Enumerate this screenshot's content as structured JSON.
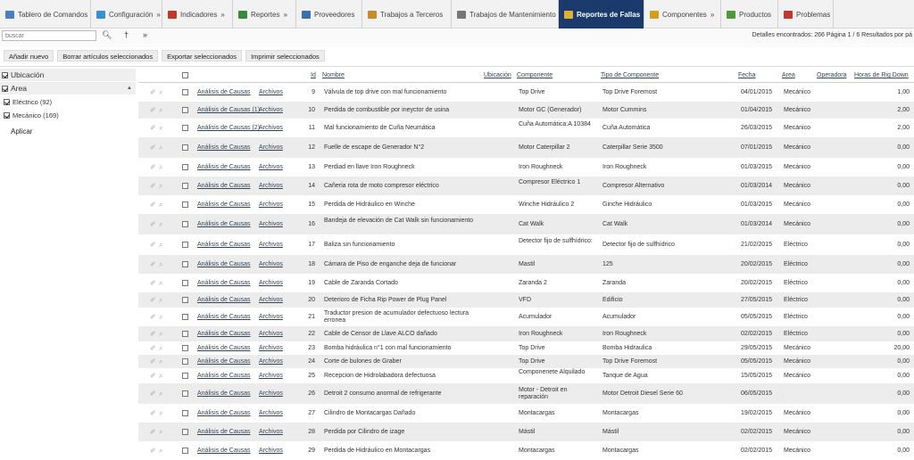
{
  "nav": {
    "tabs": [
      {
        "label": "Tablero de Comandos",
        "chev": "",
        "icon_color": "#4a7fc1",
        "width": 102,
        "active": false
      },
      {
        "label": "Configuración",
        "chev": "»",
        "icon_color": "#3a8fd0",
        "width": 80,
        "active": false
      },
      {
        "label": "Indicadores",
        "chev": "»",
        "icon_color": "#c0392b",
        "width": 79,
        "active": false
      },
      {
        "label": "Reportes",
        "chev": "»",
        "icon_color": "#3b8a3b",
        "width": 71,
        "active": false
      },
      {
        "label": "Proveedores",
        "chev": "",
        "icon_color": "#3a6fb0",
        "width": 74,
        "active": false
      },
      {
        "label": "Trabajos a Terceros",
        "chev": "",
        "icon_color": "#c98a2e",
        "width": 100,
        "active": false
      },
      {
        "label": "Trabajos de Mantenimiento",
        "chev": "",
        "icon_color": "#777777",
        "width": 120,
        "active": false
      },
      {
        "label": "Reportes de Fallas",
        "chev": "",
        "icon_color": "#e0b030",
        "width": 96,
        "active": true
      },
      {
        "label": "Componentes",
        "chev": "»",
        "icon_color": "#d4a017",
        "width": 86,
        "active": false
      },
      {
        "label": "Productos",
        "chev": "",
        "icon_color": "#4c9a3a",
        "width": 64,
        "active": false
      },
      {
        "label": "Problemas",
        "chev": "",
        "icon_color": "#c0392b",
        "width": 62,
        "active": false
      }
    ]
  },
  "toolbar": {
    "search_placeholder": "buscar",
    "status": "Detalles encontrados: 266  Página 1 / 6  Resultados por pá"
  },
  "actions": [
    "Añadir nuevo",
    "Borrar artículos seleccionados",
    "Exportar seleccionados",
    "Imprimir seleccionados"
  ],
  "sidebar": {
    "facets": [
      {
        "label": "Ubicación",
        "checked": true,
        "tri": ""
      },
      {
        "label": "Area",
        "checked": true,
        "tri": "▲"
      }
    ],
    "items": [
      {
        "label": "Eléctrico (92)",
        "checked": true
      },
      {
        "label": "Mecánico (169)",
        "checked": true
      }
    ],
    "apply": "Aplicar"
  },
  "table": {
    "headers": [
      "Id",
      "Nombre",
      "Ubicación",
      "Componente",
      "Tipo de Componente",
      "Fecha",
      "Area",
      "Operadora",
      "Horas de Rig Down"
    ],
    "rows": [
      {
        "analisis": "Análisis de Causas",
        "archivos": "Archivos",
        "id": "9",
        "nombre": "Válvula de top drive con mal funcionamiento",
        "componente": "Top Drive",
        "tipo": "Top Drive Foremost",
        "fecha": "04/01/2015",
        "area": "Mecánico",
        "horas": "1,00"
      },
      {
        "analisis": "Análisis de Causas (1)",
        "archivos": "Archivos",
        "id": "10",
        "nombre": "Perdida de combustible por ineyctor de usina",
        "componente": "Motor GC (Generador)",
        "tipo": "Motor Cummins",
        "fecha": "01/04/2015",
        "area": "Mecánico",
        "horas": "2,00"
      },
      {
        "analisis": "Análisis de Causas (2)",
        "archivos": "Archivos",
        "id": "11",
        "nombre": "Mal funcionamiento de Cuña Neumática",
        "componente": "Cuña Automática:A 10384",
        "tipo": "Cuña Automática",
        "fecha": "26/03/2015",
        "area": "Mecánico",
        "horas": "2,00"
      },
      {
        "analisis": "Análisis de Causas",
        "archivos": "Archivos",
        "id": "12",
        "nombre": "Fuelle de escape de Generador N°2",
        "componente": "Motor Caterpillar 2",
        "tipo": "Caterpillar Serie 3500",
        "fecha": "07/01/2015",
        "area": "Mecánico",
        "horas": "0,00"
      },
      {
        "analisis": "Análisis de Causas",
        "archivos": "Archivos",
        "id": "13",
        "nombre": "Perdiad en llave Iron Roughneck",
        "componente": "Iron Roughneck",
        "tipo": "Iron Roughneck",
        "fecha": "01/03/2015",
        "area": "Mecánico",
        "horas": "0,00"
      },
      {
        "analisis": "Análisis de Causas",
        "archivos": "Archivos",
        "id": "14",
        "nombre": "Cañeria rota de moto compresor eléctrico",
        "componente": "Compresor Eléctrico 1",
        "tipo": "Compresor Alternativo",
        "fecha": "01/03/2014",
        "area": "Mecánico",
        "horas": "0,00"
      },
      {
        "analisis": "Análisis de Causas",
        "archivos": "Archivos",
        "id": "15",
        "nombre": "Perdida de Hidráulico en Winche",
        "componente": "Winche Hidráulico 2",
        "tipo": "Ginche Hidráulico",
        "fecha": "01/03/2015",
        "area": "Mecánico",
        "horas": "0,00"
      },
      {
        "analisis": "Análisis de Causas",
        "archivos": "Archivos",
        "id": "16",
        "nombre": "Bandeja de elevación de Cat Walk sin funcionamiento",
        "componente": "Cat Walk",
        "tipo": "Cat Walk",
        "fecha": "01/03/2014",
        "area": "Mecánico",
        "horas": "0,00"
      },
      {
        "analisis": "Análisis de Causas",
        "archivos": "Archivos",
        "id": "17",
        "nombre": "Baliza sin funcionamiento",
        "componente": "Detector fijo de sulfhídrico:",
        "tipo": "Detector fijo de sulfhídrico",
        "fecha": "21/02/2015",
        "area": "Eléctrico",
        "horas": "0,00"
      },
      {
        "analisis": "Análisis de Causas",
        "archivos": "Archivos",
        "id": "18",
        "nombre": "Cámara de Piso de enganche deja de funcionar",
        "componente": "Mastil",
        "tipo": "125",
        "fecha": "20/02/2015",
        "area": "Eléctrico",
        "horas": "0,00"
      },
      {
        "analisis": "Análisis de Causas",
        "archivos": "Archivos",
        "id": "19",
        "nombre": "Cable de Zaranda Cortado",
        "componente": "Zaranda 2",
        "tipo": "Zaranda",
        "fecha": "20/02/2015",
        "area": "Eléctrico",
        "horas": "0,00"
      },
      {
        "analisis": "Análisis de Causas",
        "archivos": "Archivos",
        "id": "20",
        "nombre": "Deterioro de Ficha Rip Power de Plug Panel",
        "componente": "VFD",
        "tipo": "Edificio",
        "fecha": "27/05/2015",
        "area": "Eléctrico",
        "horas": "0,00"
      },
      {
        "analisis": "Análisis de Causas",
        "archivos": "Archivos",
        "id": "21",
        "nombre": "Traductor presion de acumulador defectuoso lectura erronea",
        "componente": "Acumulador",
        "tipo": "Acumulador",
        "fecha": "05/05/2015",
        "area": "Eléctrico",
        "horas": "0,00"
      },
      {
        "analisis": "Análisis de Causas",
        "archivos": "Archivos",
        "id": "22",
        "nombre": "Cable de Censor de Llave ALCO dañado",
        "componente": "Iron Roughneck",
        "tipo": "Iron Roughneck",
        "fecha": "02/02/2015",
        "area": "Eléctrico",
        "horas": "0,00"
      },
      {
        "analisis": "Análisis de Causas",
        "archivos": "Archivos",
        "id": "23",
        "nombre": "Bomba hidráulica n°1 con mal funcionamiento",
        "componente": "Top Drive",
        "tipo": "Bomba Hidraulica",
        "fecha": "29/05/2015",
        "area": "Mecánico",
        "horas": "20,00"
      },
      {
        "analisis": "Análisis de Causas",
        "archivos": "Archivos",
        "id": "24",
        "nombre": "Corte de bulones de Graber",
        "componente": "Top Drive",
        "tipo": "Top Drive Foremost",
        "fecha": "05/05/2015",
        "area": "Mecánico",
        "horas": "0,00"
      },
      {
        "analisis": "Análisis de Causas",
        "archivos": "Archivos",
        "id": "25",
        "nombre": "Recepcion de Hidrolabadora defectuosa",
        "componente": "Componenete Alquilado",
        "tipo": "Tanque de Agua",
        "fecha": "15/05/2015",
        "area": "Mecánico",
        "horas": "0,00"
      },
      {
        "analisis": "Análisis de Causas",
        "archivos": "Archivos",
        "id": "26",
        "nombre": "Detroit 2 consumo anormal de refrigerante",
        "componente": "Motor - Detroit en reparación",
        "tipo": "Motor Detroit Diesel Serie 60",
        "fecha": "06/05/2015",
        "area": "",
        "horas": "0,00"
      },
      {
        "analisis": "Análisis de Causas",
        "archivos": "Archivos",
        "id": "27",
        "nombre": "Cilindro de Montacargas Dañado",
        "componente": "Montacargas",
        "tipo": "Montacargas",
        "fecha": "19/02/2015",
        "area": "Mecánico",
        "horas": "0,00"
      },
      {
        "analisis": "Análisis de Causas",
        "archivos": "Archivos",
        "id": "28",
        "nombre": "Perdida por Cilindro de izage",
        "componente": "Mástil",
        "tipo": "Mástil",
        "fecha": "02/02/2015",
        "area": "Mecánico",
        "horas": "0,00"
      },
      {
        "analisis": "Análisis de Causas",
        "archivos": "Archivos",
        "id": "29",
        "nombre": "Perdida de Hidráulico en Montacargas",
        "componente": "Montacargas",
        "tipo": "Montacargas",
        "fecha": "02/02/2015",
        "area": "Mecánico",
        "horas": "0,00"
      }
    ]
  }
}
